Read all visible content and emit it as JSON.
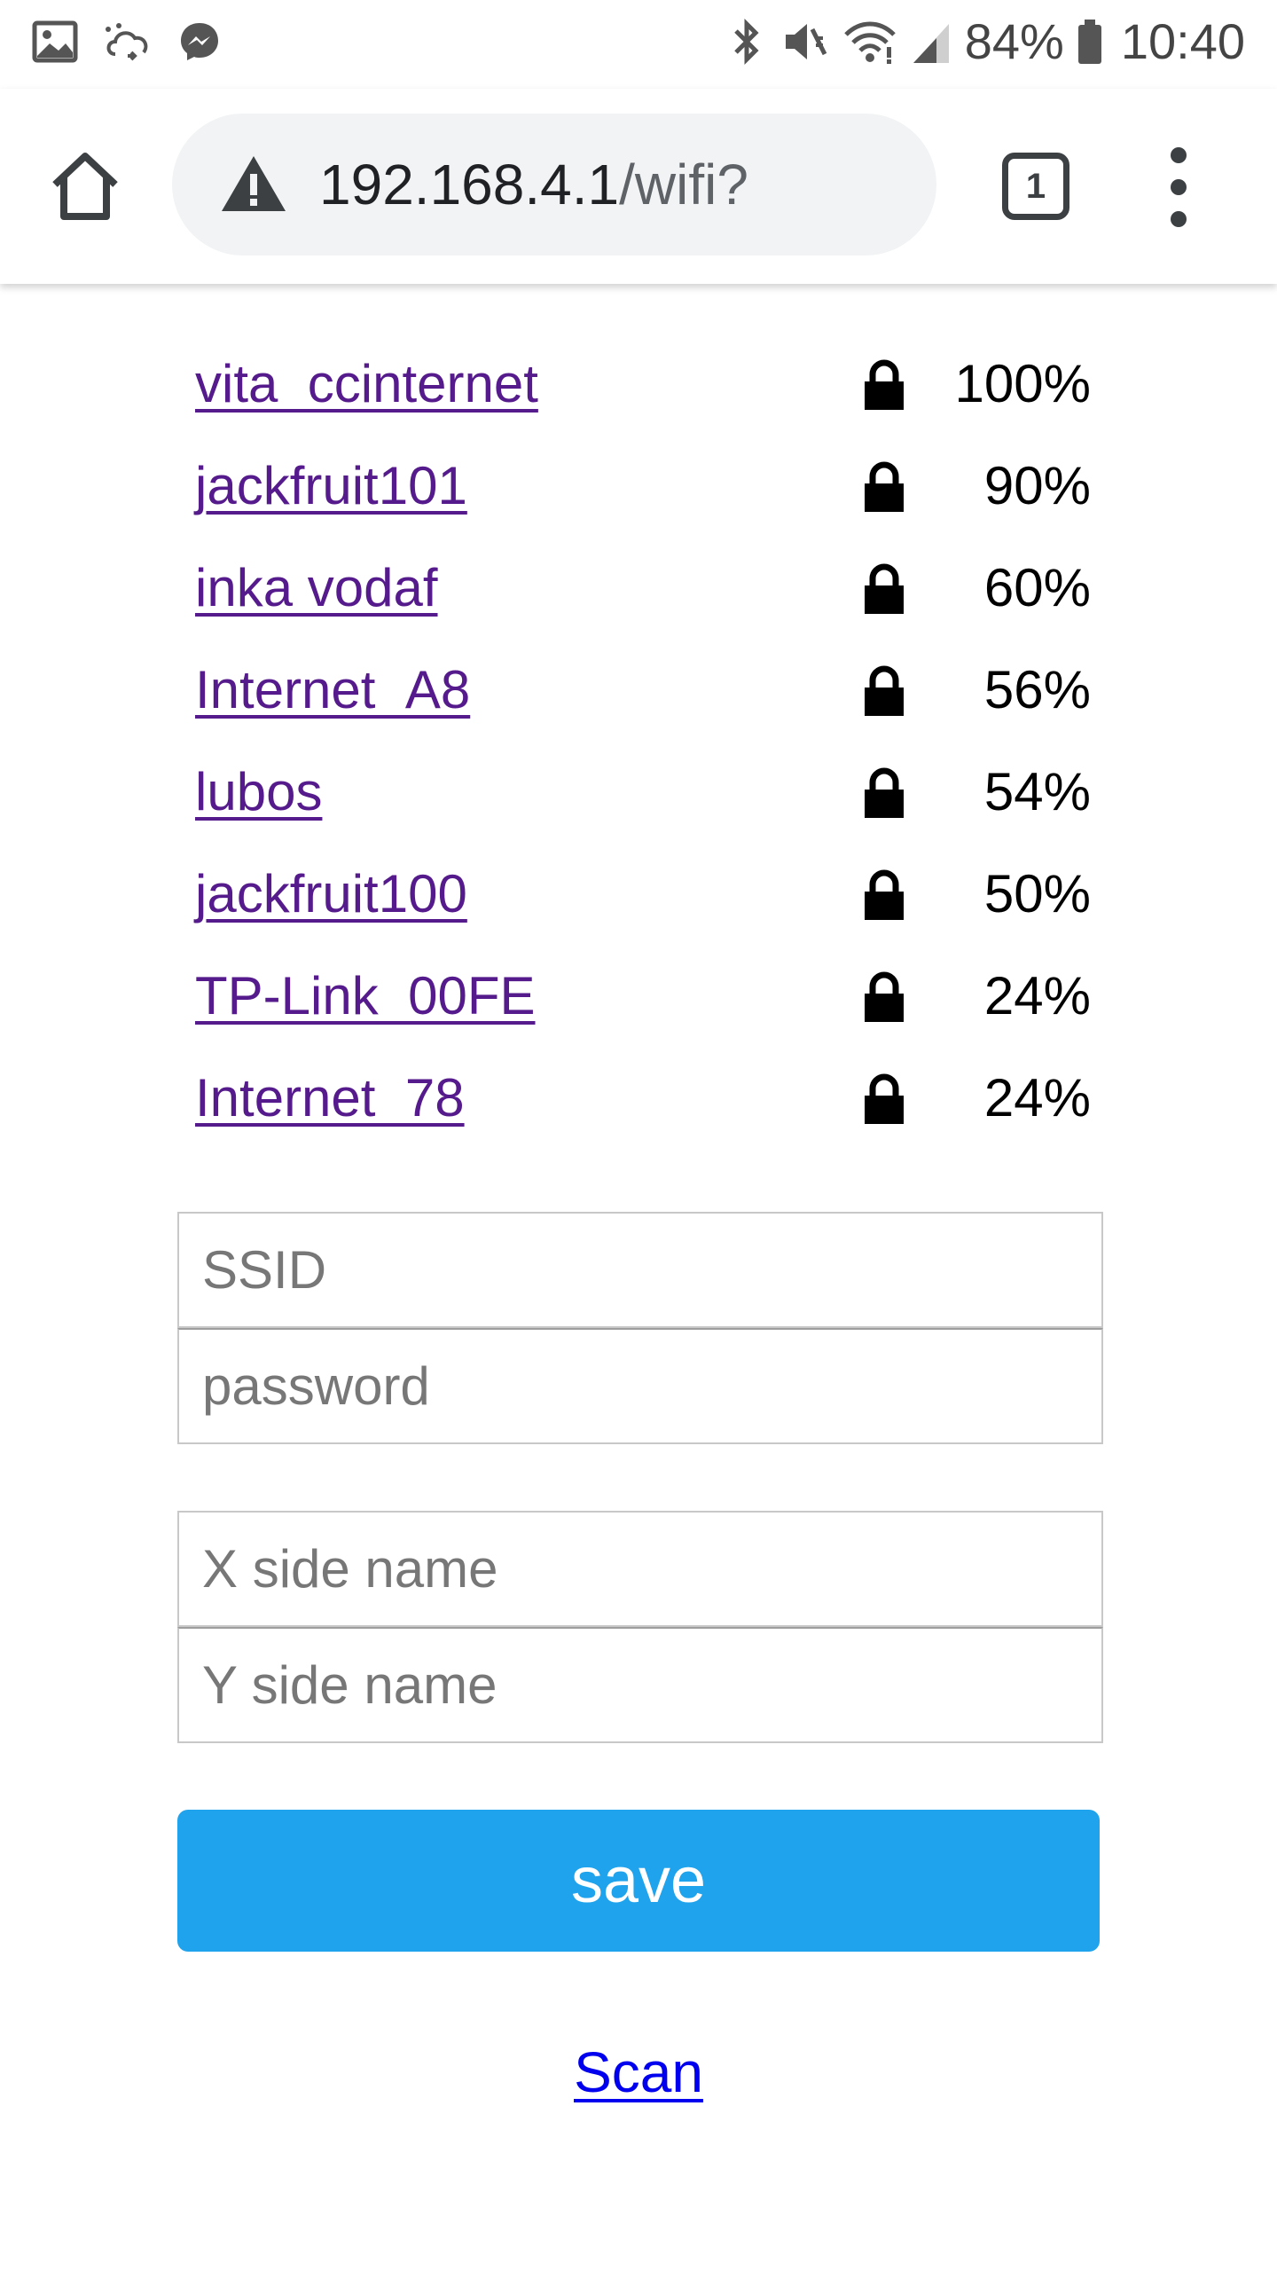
{
  "status_bar": {
    "left_icons": [
      "gallery-icon",
      "sync-cloud-icon",
      "messenger-icon"
    ],
    "right_icons": [
      "bluetooth-icon",
      "vibrate-mute-icon",
      "wifi-icon",
      "signal-icon"
    ],
    "battery": "84%",
    "time": "10:40"
  },
  "toolbar": {
    "url_host": "192.168.4.1",
    "url_path": "/wifi?",
    "tab_count": "1"
  },
  "networks": [
    {
      "ssid": "vita_ccinternet",
      "strength": "100%"
    },
    {
      "ssid": "jackfruit101",
      "strength": "90%"
    },
    {
      "ssid": "inka vodaf",
      "strength": "60%"
    },
    {
      "ssid": "Internet_A8",
      "strength": "56%"
    },
    {
      "ssid": "lubos",
      "strength": "54%"
    },
    {
      "ssid": "jackfruit100",
      "strength": "50%"
    },
    {
      "ssid": "TP-Link_00FE",
      "strength": "24%"
    },
    {
      "ssid": "Internet_78",
      "strength": "24%"
    }
  ],
  "form": {
    "ssid_placeholder": "SSID",
    "password_placeholder": "password",
    "x_side_placeholder": "X side name",
    "y_side_placeholder": "Y side name",
    "save_label": "save",
    "scan_label": "Scan"
  },
  "colors": {
    "visited_link": "#551a8b",
    "link": "#0000ee",
    "save_button": "#1fa3ec"
  }
}
